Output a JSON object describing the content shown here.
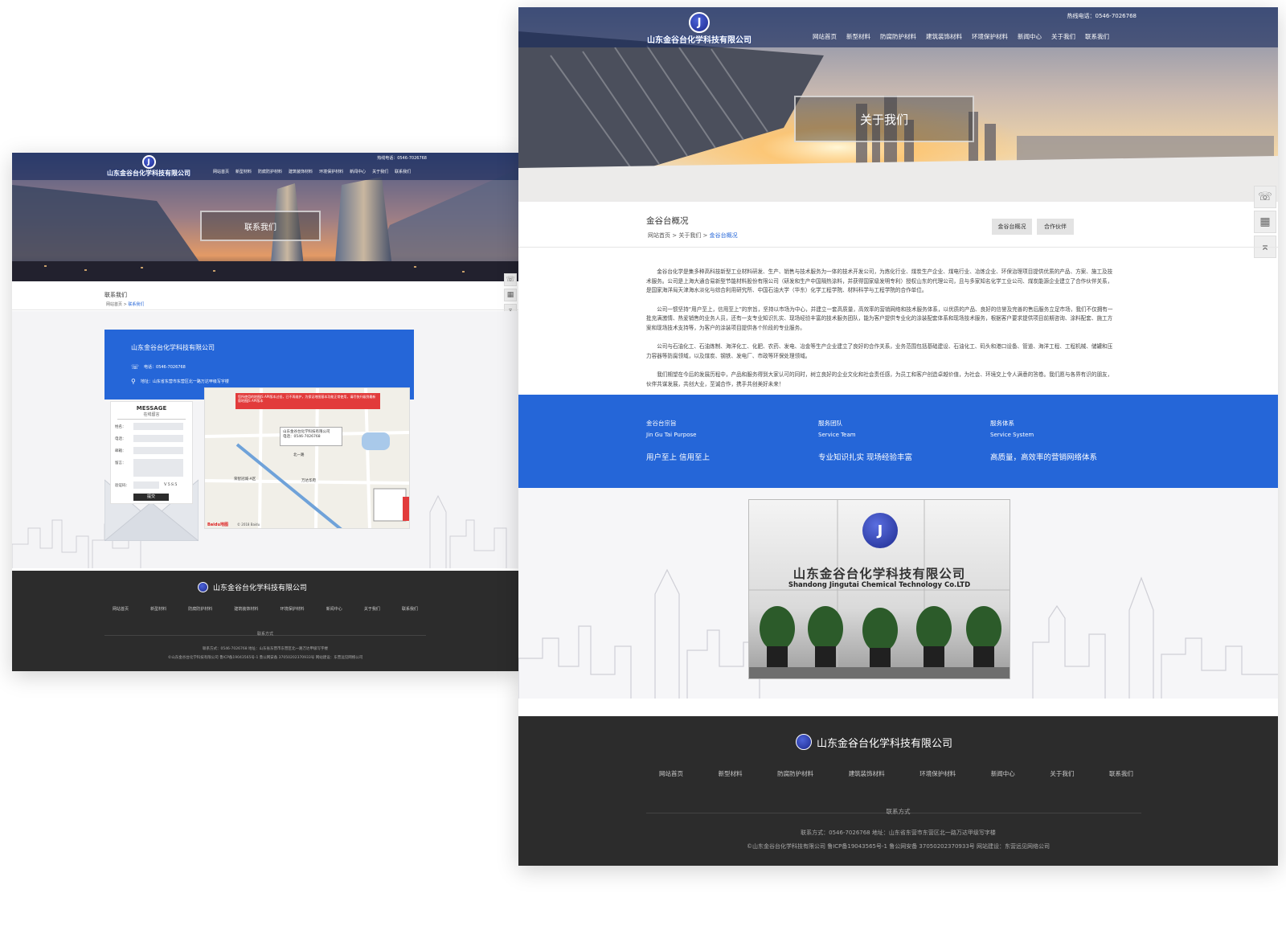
{
  "company": "山东金谷台化学科技有限公司",
  "logo_glyph": "J",
  "nav_items": [
    "网站首页",
    "新型材料",
    "防腐防护材料",
    "建筑装饰材料",
    "环境保护材料",
    "新闻中心",
    "关于我们",
    "联系我们"
  ],
  "hotline": "热线电话：0546-7026768",
  "left_page": {
    "hotline": "热线电话：0546-7026768",
    "banner_title": "联系我们",
    "section_title": "联系我们",
    "breadcrumb_home": "网站首页",
    "breadcrumb_current": "联系我们",
    "contact_company": "山东金谷台化学科技有限公司",
    "contact_phone": "电话：0546-7026768",
    "contact_address": "地址：山东省东营市东营区北一路万达甲级写字楼",
    "message_title": "MESSAGE",
    "message_subtitle": "在线留言",
    "field_name": "姓名：",
    "field_phone": "电话：",
    "field_email": "邮箱：",
    "field_message": "留言：",
    "field_captcha": "验证码：",
    "captcha_text": "V5S5",
    "submit_label": "提交",
    "map_warning": "您所使用的地图JS API版本过低，已不再维护，为保证地图基本功能正常使用，请尽快升级到最新版地图JS API版本",
    "map_popup_name": "山东金谷台化学科技有限公司",
    "map_popup_phone": "电话：0546-7026768",
    "map_label_wanda": "万达华府",
    "map_label_ring": "荣智冠城-A区",
    "map_label_beiyi": "北一路",
    "map_brand": "Baidu地图",
    "map_copyright": "© 2018 Baidu",
    "footer_contact_title": "联系方式",
    "footer_contact": "联系方式：0546-7026768    地址：山东省东营市东营区北一路万达甲级写字楼",
    "footer_copy": "©山东金谷台化学科技有限公司    鲁ICP备19043565号-1    鲁公网安备 37050202370933号    网站建设：东营远见网络公司"
  },
  "right_page": {
    "hotline": "热线电话：0546-7026768",
    "banner_title": "关于我们",
    "section_title": "金谷台概况",
    "breadcrumb_home": "网站首页",
    "breadcrumb_mid": "关于我们",
    "breadcrumb_current": "金谷台概况",
    "tab_overview": "金谷台概况",
    "tab_partners": "合作伙伴",
    "paragraphs": [
      "金谷台化学是集多种高科技新型工业材料研发、生产、销售与技术服务为一体的技术开发公司，为炼化行业、煤炭生产企业、煤电行业、冶炼企业、环保治理项目提供优质的产品、方案、施工及技术服务。公司是上海大通合易新型节能材料股份有限公司（研发和生产中国隔热涂料，并获得国家级发明专利）授权山东的代理公司，且与多家知名化学工业公司、煤炭能源企业建立了合作伙伴关系，是国家海洋局天津海水淡化与综合利用研究所、中国石油大学（华东）化学工程学院、材料科学与工程学院的合作单位。",
      "公司一惯坚持“用户至上，信用至上”的宗旨，坚持以市场为中心，并建立一套高质量，高效率的营销网络和技术服务体系，以优质的产品、良好的信誉及完善的售后服务立足市场，我们不仅拥有一批充满激情、热爱销售的业务人员，还有一支专业知识扎实、现场经验丰富的技术服务团队，能为客户提供专业化的涂装配套体系和现场技术服务，根据客户要求提供项目前期咨询、涂料配套、施工方案和现场技术支持等，为客户的涂装项目提供各个阶段的专业服务。",
      "公司与石油化工、石油炼制、海洋化工、化肥、农药、发电、冶金等生产企业建立了良好的合作关系，业务范围包括基础建设、石油化工、码头和港口设备、管道、海洋工程、工程机械、储罐和压力容器等防腐领域，以及煤炭、钢铁、发电厂、市政等环保处理领域。",
      "我们期望在今后的发展历程中，产品和服务得到大家认可的同时，树立良好的企业文化和社会责任感，为员工和客户创造卓越价值，为社会、环境交上令人满意的答卷。我们愿与各界有识的朋友，伙伴共谋发展，共创大业，至诚合作，携手共创美好未来！"
    ],
    "values": [
      {
        "title": "金谷台宗旨",
        "subtitle": "Jin Gu Tai Purpose",
        "body": "用户至上 信用至上"
      },
      {
        "title": "服务团队",
        "subtitle": "Service Team",
        "body": "专业知识扎实 现场经验丰富"
      },
      {
        "title": "服务体系",
        "subtitle": "Service System",
        "body": "高质量，高效率的营销网络体系"
      }
    ],
    "photo_cn": "山东金谷台化学科技有限公司",
    "photo_en": "Shandong Jingutai Chemical Technology Co.LTD",
    "footer_contact_title": "联系方式",
    "footer_contact": "联系方式：0546-7026768    地址：山东省东营市东营区北一路万达甲级写字楼",
    "footer_copy": "©山东金谷台化学科技有限公司    鲁ICP备19043565号-1    鲁公网安备 37050202370933号    网站建设：东营远见网络公司"
  },
  "icons": {
    "phone": "☏",
    "qr": "▦",
    "top": "⌅",
    "pin": "⚲"
  },
  "colors": {
    "brand_blue": "#2566d8",
    "footer_bg": "#2c2c2c",
    "nav_bg": "#16285a"
  }
}
